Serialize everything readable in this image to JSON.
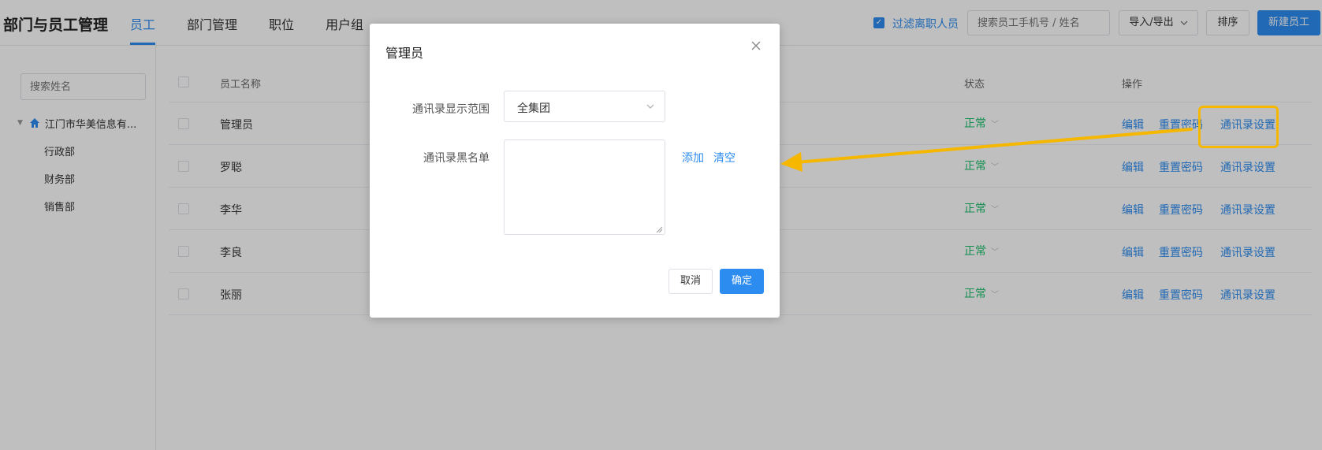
{
  "header": {
    "app_title": "部门与员工管理",
    "tabs": [
      {
        "label": "员工",
        "active": true
      },
      {
        "label": "部门管理",
        "active": false
      },
      {
        "label": "职位",
        "active": false
      },
      {
        "label": "用户组",
        "active": false
      }
    ],
    "filter_label": "过滤离职人员",
    "filter_checked": true,
    "search_placeholder": "搜索员工手机号 / 姓名",
    "import_export_label": "导入/导出",
    "sort_label": "排序",
    "new_employee_label": "新建员工"
  },
  "sidebar": {
    "search_placeholder": "搜索姓名",
    "root_label": "江门市华美信息有...",
    "children": [
      "行政部",
      "财务部",
      "销售部"
    ]
  },
  "table": {
    "columns": {
      "name": "员工名称",
      "status": "状态",
      "actions": "操作"
    },
    "rows": [
      {
        "name": "管理员",
        "status": "正常"
      },
      {
        "name": "罗聪",
        "status": "正常"
      },
      {
        "name": "李华",
        "status": "正常"
      },
      {
        "name": "李良",
        "status": "正常"
      },
      {
        "name": "张丽",
        "status": "正常"
      }
    ],
    "actions": {
      "edit": "编辑",
      "reset_password": "重置密码",
      "contacts_settings": "通讯录设置"
    }
  },
  "modal": {
    "title": "管理员",
    "scope_label": "通讯录显示范围",
    "scope_value": "全集团",
    "blacklist_label": "通讯录黑名单",
    "add_label": "添加",
    "clear_label": "清空",
    "cancel_label": "取消",
    "ok_label": "确定"
  },
  "colors": {
    "accent": "#2d8cf0",
    "status_ok": "#19be6b",
    "annotation": "#f5b700"
  }
}
